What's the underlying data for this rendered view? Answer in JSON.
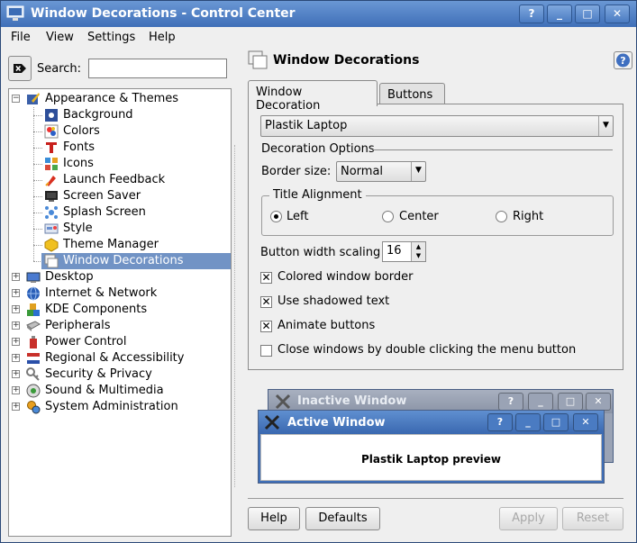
{
  "window": {
    "title": "Window Decorations - Control Center",
    "buttons": {
      "help": "?",
      "minimize": "_",
      "maximize": "□",
      "close": "✕"
    }
  },
  "menubar": {
    "items": [
      "File",
      "View",
      "Settings",
      "Help"
    ]
  },
  "search": {
    "label": "Search:",
    "value": ""
  },
  "tree": {
    "items": [
      {
        "label": "Appearance & Themes",
        "icon": "appearance-icon",
        "expanded": true
      },
      {
        "label": "Background",
        "icon": "background-icon"
      },
      {
        "label": "Colors",
        "icon": "colors-icon"
      },
      {
        "label": "Fonts",
        "icon": "fonts-icon"
      },
      {
        "label": "Icons",
        "icon": "icons-icon"
      },
      {
        "label": "Launch Feedback",
        "icon": "launch-feedback-icon"
      },
      {
        "label": "Screen Saver",
        "icon": "screen-saver-icon"
      },
      {
        "label": "Splash Screen",
        "icon": "splash-screen-icon"
      },
      {
        "label": "Style",
        "icon": "style-icon"
      },
      {
        "label": "Theme Manager",
        "icon": "theme-manager-icon"
      },
      {
        "label": "Window Decorations",
        "icon": "window-decorations-icon",
        "selected": true
      },
      {
        "label": "Desktop",
        "icon": "desktop-icon"
      },
      {
        "label": "Internet & Network",
        "icon": "internet-icon"
      },
      {
        "label": "KDE Components",
        "icon": "kde-components-icon"
      },
      {
        "label": "Peripherals",
        "icon": "peripherals-icon"
      },
      {
        "label": "Power Control",
        "icon": "power-control-icon"
      },
      {
        "label": "Regional & Accessibility",
        "icon": "regional-icon"
      },
      {
        "label": "Security & Privacy",
        "icon": "security-icon"
      },
      {
        "label": "Sound & Multimedia",
        "icon": "sound-icon"
      },
      {
        "label": "System Administration",
        "icon": "system-admin-icon"
      }
    ]
  },
  "module": {
    "title": "Window Decorations",
    "tabs": [
      {
        "label": "Window Decoration",
        "active": true
      },
      {
        "label": "Buttons",
        "active": false
      }
    ],
    "decoration_combo": "Plastik Laptop",
    "decoration_options_label": "Decoration Options",
    "border_size_label": "Border size:",
    "border_size_value": "Normal",
    "title_alignment": {
      "label": "Title Alignment",
      "options": [
        {
          "label": "Left",
          "checked": true
        },
        {
          "label": "Center",
          "checked": false
        },
        {
          "label": "Right",
          "checked": false
        }
      ]
    },
    "button_width_label": "Button width scaling",
    "button_width_value": "16",
    "checkboxes": [
      {
        "label": "Colored window border",
        "checked": true
      },
      {
        "label": "Use shadowed text",
        "checked": true
      },
      {
        "label": "Animate buttons",
        "checked": true
      },
      {
        "label": "Close windows by double clicking the menu button",
        "checked": false
      }
    ]
  },
  "preview": {
    "inactive_title": "Inactive Window",
    "active_title": "Active Window",
    "body_text": "Plastik Laptop preview",
    "button_labels": {
      "help": "?",
      "minimize": "_",
      "maximize": "□",
      "close": "✕"
    }
  },
  "buttons": {
    "help": "Help",
    "defaults": "Defaults",
    "apply": "Apply",
    "reset": "Reset"
  },
  "colors": {
    "titlebar": "#4f80c4",
    "selection": "#7193c5",
    "preview_active": "#3f6fb8",
    "preview_inactive": "#8d96a8"
  }
}
